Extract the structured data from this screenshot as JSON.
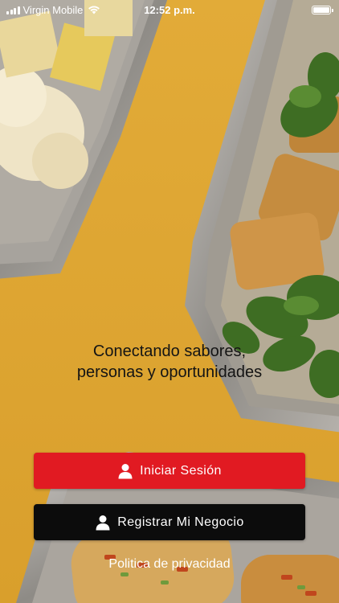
{
  "status_bar": {
    "carrier": "Virgin Mobile",
    "time": "12:52 p.m.",
    "icons": [
      "signal-icon",
      "wifi-icon",
      "battery-icon"
    ]
  },
  "tagline": {
    "line1": "Conectando sabores,",
    "line2": "personas y oportunidades"
  },
  "actions": {
    "login_label": "Iniciar Sesión",
    "register_label": "Registrar Mi Negocio",
    "privacy_label": "Politica de privacidad"
  },
  "colors": {
    "background": "#dfa733",
    "login_button": "#e11a22",
    "register_button": "#0c0c0c",
    "text_dark": "#141414",
    "text_light": "#ffffff"
  }
}
